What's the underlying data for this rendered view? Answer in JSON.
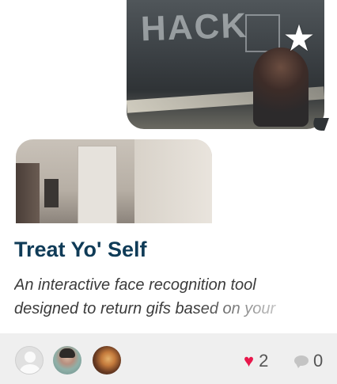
{
  "images": {
    "top": {
      "subject": "hackathon-chalkboard",
      "overlay_text": "HACK"
    },
    "second": {
      "subject": "hallway"
    }
  },
  "icons": {
    "favorite": "star-icon",
    "like": "heart-icon",
    "comment": "comment-icon"
  },
  "project": {
    "title": "Treat Yo' Self",
    "description_line1": "An interactive face recognition tool",
    "description_line2": "designed to return gifs based on your"
  },
  "footer": {
    "like_count": "2",
    "comment_count": "0"
  },
  "colors": {
    "title": "#0f3b57",
    "heart": "#e8174b",
    "footer_bg": "#efefef",
    "star": "#ffffff"
  }
}
